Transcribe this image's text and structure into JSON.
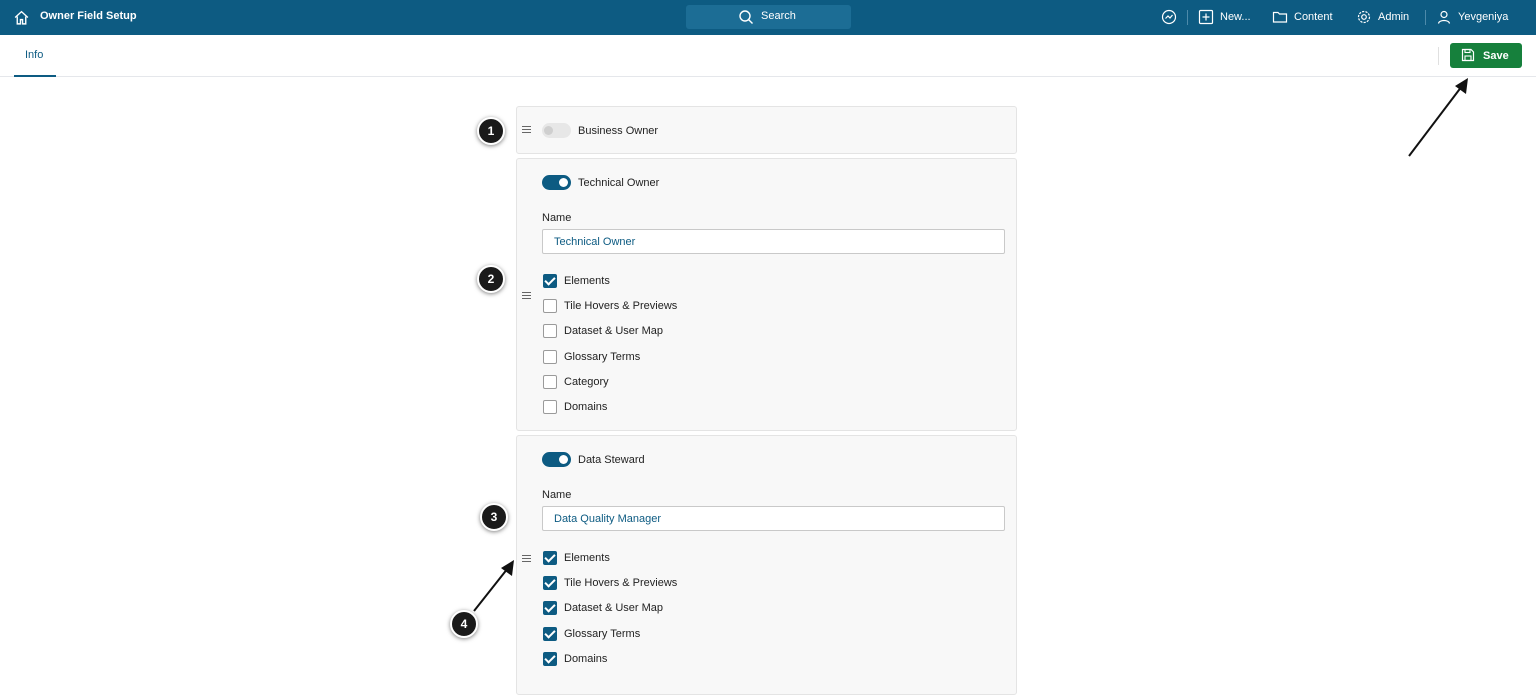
{
  "header": {
    "title": "Owner Field Setup",
    "search_label": "Search",
    "new_label": "New...",
    "content_label": "Content",
    "admin_label": "Admin",
    "user_label": "Yevgeniya"
  },
  "tabs": [
    {
      "label": "Info",
      "active": true
    }
  ],
  "save_label": "Save",
  "name_label": "Name",
  "cards": [
    {
      "title": "Business Owner",
      "enabled": false
    },
    {
      "title": "Technical Owner",
      "enabled": true,
      "name_value": "Technical Owner",
      "options": [
        {
          "label": "Elements",
          "checked": true
        },
        {
          "label": "Tile Hovers & Previews",
          "checked": false
        },
        {
          "label": "Dataset & User Map",
          "checked": false
        },
        {
          "label": "Glossary Terms",
          "checked": false
        },
        {
          "label": "Category",
          "checked": false
        },
        {
          "label": "Domains",
          "checked": false
        }
      ]
    },
    {
      "title": "Data Steward",
      "enabled": true,
      "name_value": "Data Quality Manager",
      "options": [
        {
          "label": "Elements",
          "checked": true
        },
        {
          "label": "Tile Hovers & Previews",
          "checked": true
        },
        {
          "label": "Dataset & User Map",
          "checked": true
        },
        {
          "label": "Glossary Terms",
          "checked": true
        },
        {
          "label": "Domains",
          "checked": true
        }
      ]
    }
  ],
  "annotations": [
    "1",
    "2",
    "3",
    "4"
  ],
  "colors": {
    "header": "#0d5b82",
    "save": "#16803c",
    "accent": "#0d5b82"
  }
}
